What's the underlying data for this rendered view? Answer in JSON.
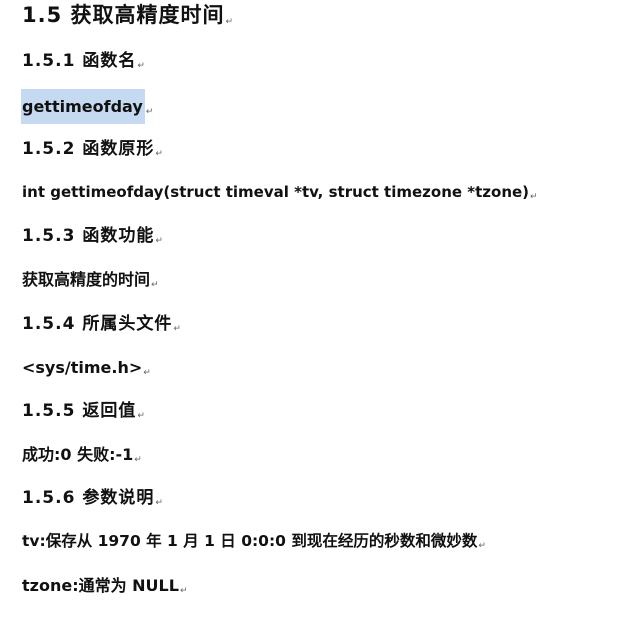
{
  "paragraph_mark": "↵",
  "selection_color": "#c5d9f1",
  "title": "1.5 获取高精度时间",
  "sections": [
    {
      "heading": "1.5.1 函数名",
      "content": "gettimeofday"
    },
    {
      "heading": "1.5.2 函数原形",
      "content": "int gettimeofday(struct timeval *tv, struct timezone *tzone)"
    },
    {
      "heading": "1.5.3 函数功能",
      "content": "获取高精度的时间"
    },
    {
      "heading": "1.5.4 所属头文件",
      "content": "<sys/time.h>"
    },
    {
      "heading": "1.5.5 返回值",
      "content": "成功:0 失败:-1"
    },
    {
      "heading": "1.5.6 参数说明",
      "content": [
        "tv:保存从 1970 年 1 月 1 日 0:0:0 到现在经历的秒数和微妙数",
        "tzone:通常为 NULL"
      ]
    }
  ]
}
